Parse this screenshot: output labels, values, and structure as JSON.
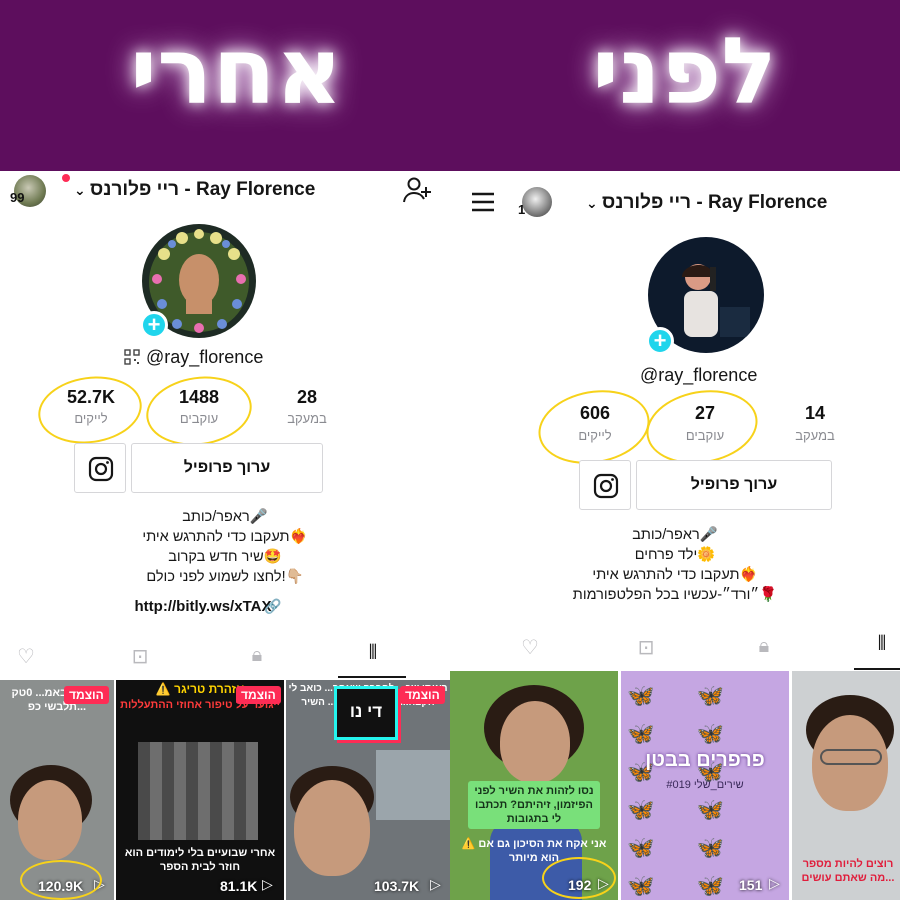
{
  "banner": {
    "after_word": "אחרי",
    "before_word": "לפני"
  },
  "after": {
    "notification_count": "99",
    "title": "ריי פלורנס - Ray Florence",
    "handle": "@ray_florence",
    "stats": [
      {
        "value": "52.7K",
        "label": "לייקים"
      },
      {
        "value": "1488",
        "label": "עוקבים"
      },
      {
        "value": "28",
        "label": "במעקב"
      }
    ],
    "edit_profile": "ערוך פרופיל",
    "bio": [
      "ראפר/כותב🎤",
      "תעקבו כדי להתרגש איתי❤️‍🔥",
      "שיר חדש בקרוב🤩",
      "לחצו לשמוע לפני כולם!👇🏼"
    ],
    "link": "http://bitly.ws/xTAX",
    "videos": [
      {
        "pinned": "הוצמד",
        "caption": "אני לא באמ... 0טק תלבשי כפ...",
        "views": "120.9K"
      },
      {
        "pinned": "הוצמד",
        "caption_top": "⚠️ אזהרת טריגר",
        "caption_sub": "ייגוער על טיפור אחוזי ההתעללות",
        "caption_bottom": "אחרי שבועיים בלי לימודים הוא חוזר לבית הספר",
        "views": "81.1K"
      },
      {
        "pinned": "הוצמד",
        "logo": "די נו",
        "caption": "ראיתי שכ... לחברה שאחר... כואב לי הקצה... אנשים עדיין ל... השיר",
        "views": "103.7K"
      }
    ]
  },
  "before": {
    "notification_count": "1",
    "title": "ריי פלורנס - Ray Florence",
    "handle": "@ray_florence",
    "stats": [
      {
        "value": "606",
        "label": "לייקים"
      },
      {
        "value": "27",
        "label": "עוקבים"
      },
      {
        "value": "14",
        "label": "במעקב"
      }
    ],
    "edit_profile": "ערוך פרופיל",
    "bio": [
      "ראפר/כותב🎤",
      "ילד פרחים🌼",
      "תעקבו כדי להתרגש איתי❤️‍🔥",
      "״ורד״-עכשיו בכל הפלטפורמות🌹"
    ],
    "videos": [
      {
        "caption": "נסו לזהות את השיר לפני הפיזמון, זיהיתם? תכתבו לי בתגובות",
        "caption_bottom": "⚠️ אני אקח את הסיכון גם אם הוא מיותר",
        "views": "192"
      },
      {
        "caption": "פרפרים בבטן",
        "caption_sub": "#שירים_שלי 019",
        "views": "151"
      },
      {
        "caption": "רוצים להיות מספר ...מה שאתם עושים",
        "views": ""
      }
    ]
  },
  "icons": [
    "add-user-icon",
    "menu-icon",
    "qr-code-icon",
    "instagram-icon",
    "liked-videos-icon",
    "favorites-icon",
    "private-icon",
    "videos-grid-icon",
    "play-icon"
  ]
}
